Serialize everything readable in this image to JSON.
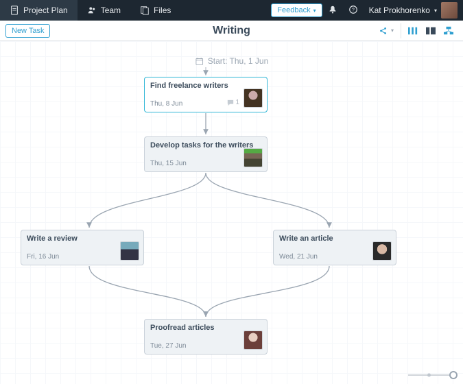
{
  "nav": {
    "tabs": [
      {
        "label": "Project Plan",
        "icon": "doc-icon",
        "active": true
      },
      {
        "label": "Team",
        "icon": "team-icon",
        "active": false
      },
      {
        "label": "Files",
        "icon": "files-icon",
        "active": false
      }
    ],
    "feedback_label": "Feedback",
    "user_name": "Kat Prokhorenko"
  },
  "toolbar": {
    "new_task_label": "New Task",
    "title": "Writing"
  },
  "start": {
    "label": "Start: Thu, 1 Jun"
  },
  "tasks": {
    "t1": {
      "title": "Find freelance writers",
      "date": "Thu, 8 Jun",
      "comments": "1"
    },
    "t2": {
      "title": "Develop tasks for the writers",
      "date": "Thu, 15 Jun"
    },
    "t3": {
      "title": "Write a review",
      "date": "Fri, 16 Jun"
    },
    "t4": {
      "title": "Write an article",
      "date": "Wed, 21 Jun"
    },
    "t5": {
      "title": "Proofread articles",
      "date": "Tue, 27 Jun"
    }
  }
}
